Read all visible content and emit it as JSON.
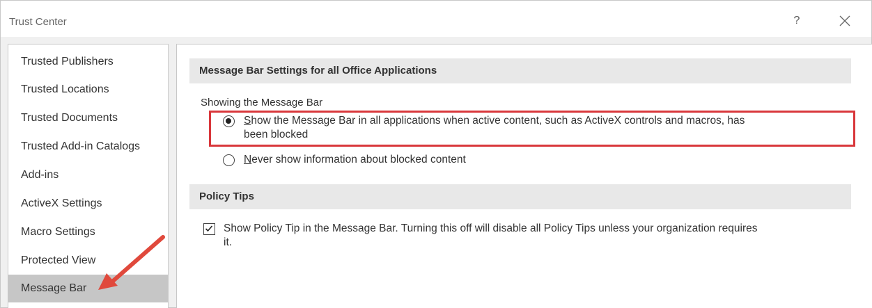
{
  "window": {
    "title": "Trust Center",
    "help_label": "?",
    "close_icon": "close-icon"
  },
  "sidebar": {
    "items": [
      {
        "label": "Trusted Publishers",
        "selected": false
      },
      {
        "label": "Trusted Locations",
        "selected": false
      },
      {
        "label": "Trusted Documents",
        "selected": false
      },
      {
        "label": "Trusted Add-in Catalogs",
        "selected": false
      },
      {
        "label": "Add-ins",
        "selected": false
      },
      {
        "label": "ActiveX Settings",
        "selected": false
      },
      {
        "label": "Macro Settings",
        "selected": false
      },
      {
        "label": "Protected View",
        "selected": false
      },
      {
        "label": "Message Bar",
        "selected": true
      }
    ]
  },
  "message_bar_section": {
    "header": "Message Bar Settings for all Office Applications",
    "group_label": "Showing the Message Bar",
    "option_show": {
      "underlined": "S",
      "text_line1": "how the Message Bar in all applications when active content, such as ActiveX controls and macros, has",
      "text_line2": "been blocked",
      "selected": true
    },
    "option_never": {
      "underlined": "N",
      "text": "ever show information about blocked content",
      "selected": false
    }
  },
  "policy_tips_section": {
    "header": "Policy Tips",
    "checkbox": {
      "checked": true,
      "text_line1": "Show Policy Tip in the Message Bar. Turning this off will disable all Policy Tips unless your organization requires",
      "text_line2": "it."
    }
  },
  "annotation": {
    "highlight_color": "#d9373b",
    "arrow_color": "#e0493c"
  }
}
